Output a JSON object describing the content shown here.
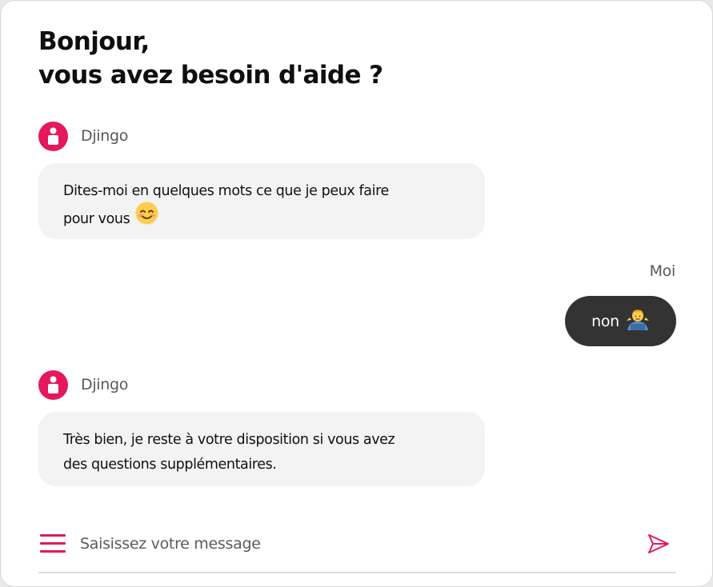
{
  "header": {
    "line1": "Bonjour,",
    "line2": "vous avez besoin d'aide ?"
  },
  "conversation": [
    {
      "sender": "Djingo",
      "text_line1": "Dites-moi en quelques mots ce que je peux faire",
      "text_line2": "pour vous",
      "emoji": "smiling-face-emoji"
    },
    {
      "sender": "Moi",
      "text": "non",
      "emoji": "man-shrugging-emoji"
    },
    {
      "sender": "Djingo",
      "text_line1": "Très bien, je reste à votre disposition si vous avez",
      "text_line2": "des questions supplémentaires."
    }
  ],
  "composer": {
    "placeholder": "Saisissez votre message",
    "value": "",
    "menu_icon": "hamburger-menu-icon",
    "send_icon": "send-icon"
  },
  "colors": {
    "accent": "#e4185a",
    "user_bubble": "#333333",
    "bot_bubble": "#f3f3f3"
  }
}
